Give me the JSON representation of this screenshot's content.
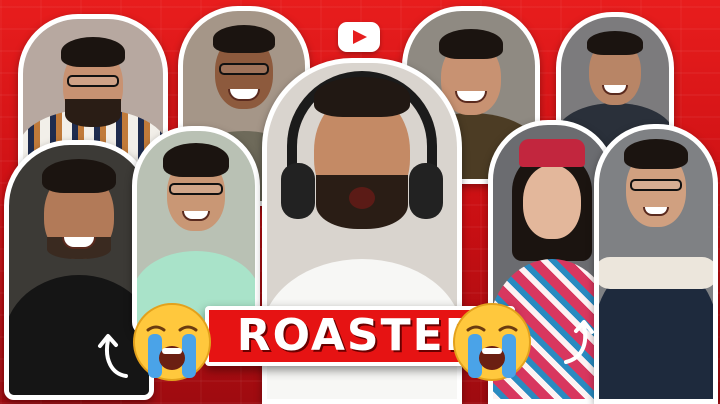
{
  "thumbnail": {
    "banner": {
      "title": "ROASTED"
    },
    "logo": {
      "icon": "youtube-play-icon"
    },
    "emojis": {
      "icon": "loudly-crying-face-emoji",
      "count": 2
    },
    "colors": {
      "background": "#d11619",
      "banner_fill": "#e61313",
      "banner_text": "#ffffff",
      "outline": "#ffffff",
      "emoji_yellow": "#ffc83d",
      "tears": "#4aa3e8"
    }
  }
}
